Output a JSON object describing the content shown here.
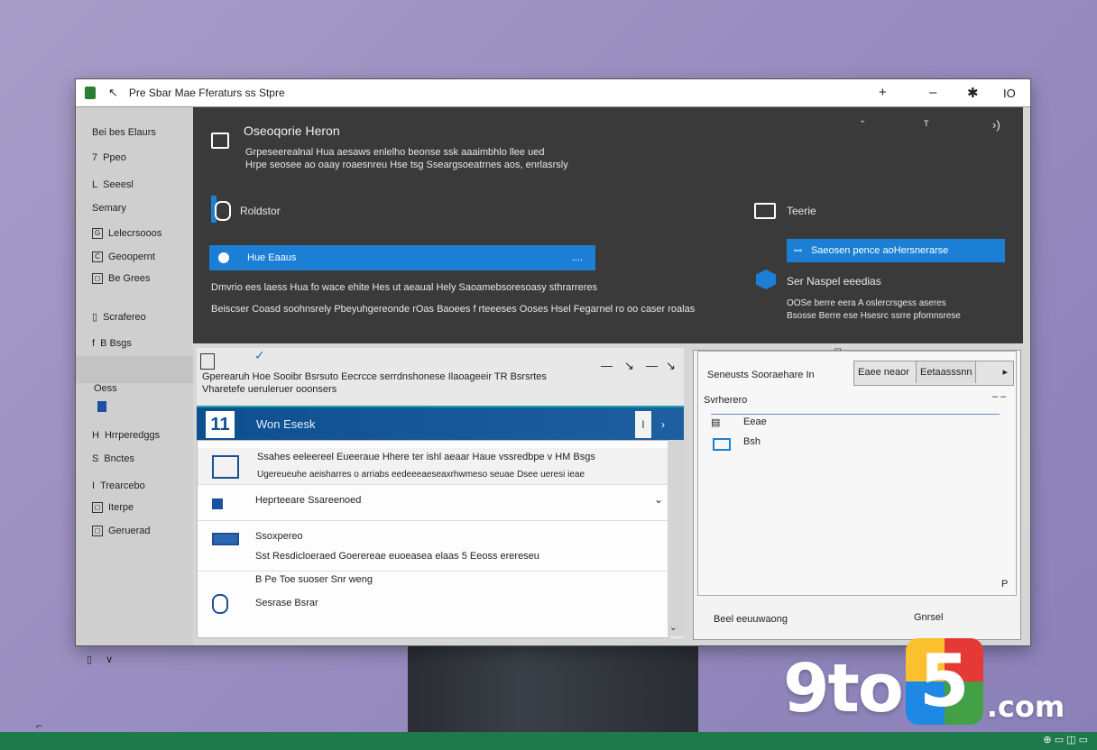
{
  "window": {
    "title": "Pre Sbar Mae Fferaturs ss Stpre",
    "controls": [
      "+",
      "–",
      "✱",
      "IO"
    ]
  },
  "sidebar": {
    "items": [
      {
        "label": "Bei bes Elaurs",
        "icon": ""
      },
      {
        "label": "Ppeo",
        "icon": "7"
      },
      {
        "label": "Seeesl",
        "icon": "L"
      },
      {
        "label": "Semary",
        "icon": ""
      },
      {
        "label": "Lelecrsooos",
        "icon": "G"
      },
      {
        "label": "Geoopernt",
        "icon": "C"
      },
      {
        "label": "Be Grees",
        "icon": "◻"
      },
      {
        "label": "Scrafereo",
        "icon": "▯"
      },
      {
        "label": "B Bsgs",
        "icon": "f"
      },
      {
        "label": "Oess",
        "icon": ""
      },
      {
        "label": "Hrrperedggs",
        "icon": "H"
      },
      {
        "label": "Bnctes",
        "icon": "S"
      },
      {
        "label": "Trearcebo",
        "icon": "I"
      },
      {
        "label": "Iterpe",
        "icon": "◻"
      },
      {
        "label": "Geruerad",
        "icon": "◻"
      }
    ],
    "bottom_icons": [
      "▯",
      "∨"
    ]
  },
  "dark_panel": {
    "heading": "Oseoqorie Heron",
    "desc1": "Grpeseerealnal Hua aesaws enlelho beonse ssk aaaimbhlo llee ued",
    "desc2": "Hrpe seosee ao oaay roaesnreu Hse tsg Sseargsoeatrnes aos, enrlasrsly",
    "section1": "Roldstor",
    "blue_bar1": "Hue Eaaus",
    "blue_bar1_right": "....",
    "line1": "Dmvrio ees laess Hua fo wace ehite Hes ut aeaual Hely Saoamebsoresoasy sthrarreres",
    "line2": "Beiscser Coasd soohnsrely Pbeyuhgereonde rOas Baoees f rteeeses Ooses Hsel Fegarnel ro oo caser roalas",
    "section2": "Teerie",
    "blue_bar2": "Saeosen pence aoHersnerarse",
    "section3": "Ser Naspel eeedias",
    "right_line1": "OOSe berre eera A oslercrsgess aseres",
    "right_line2": "Bsosse Berre ese Hsesrc ssrre pfomnsrese"
  },
  "lower_left": {
    "toolbar_glyphs": [
      "—",
      "↘",
      "—",
      "↘"
    ],
    "intro1": "Gperearuh Hoe Sooibr Bsrsuto Eecrcce serrdnshonese Ilaoageeir TR Bsrsrtes",
    "intro2": "Vharetefe ueruleruer ooonsers",
    "header_badge": "11",
    "header_label": "Won Esesk",
    "header_btn1": "l",
    "header_btn2": "›",
    "rows": [
      {
        "title": "Ssahes eeleereel Eueeraue Hhere ter ishl aeaar Haue vssredbpe v HM Bsgs",
        "subtitle": "Ugereueuhe aeisharres o arriabs eedeeeaeseaxrhwmeso seuae Dsee ueresi ieae"
      },
      {
        "title": "Heprteeare Ssareenoed"
      },
      {
        "title": "Ssoxpereo",
        "subtitle": "Sst Resdicloeraed Goerereae euoeasea elaas 5 Eeoss erereseu"
      },
      {
        "title": "B Pe Toe suoser Snr weng"
      },
      {
        "title": "Sesrase Bsrar"
      }
    ]
  },
  "right_panel": {
    "top_label": "Seneusts Sooraehare In",
    "field_btn1": "Eaee neaor",
    "field_btn2": "Eetaasssnn",
    "field_arrow": "▸",
    "list_label": "Svrherero",
    "item1": "Eeae",
    "item2": "Bsh",
    "bottom_corner": "P",
    "footer_left": "Beel eeuuwaong",
    "footer_right": "Gnrsel"
  },
  "watermark": {
    "prefix": "9to",
    "digit": "5",
    "suffix": ".com"
  },
  "colors": {
    "accent_blue": "#1b7fd6",
    "header_blue": "#0e4f8f",
    "dark_panel": "#3a3a3a",
    "floor_green": "#1e7a4c"
  }
}
